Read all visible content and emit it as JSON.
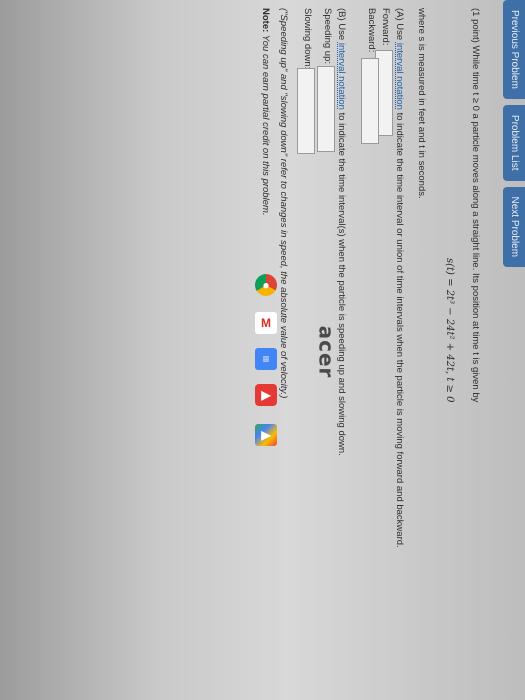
{
  "nav": {
    "previous": "Previous Problem",
    "list": "Problem List",
    "next": "Next Problem"
  },
  "problem": {
    "intro": "(1 point) While time t ≥ 0 a particle moves along a straight line. Its position at time t is given by",
    "equation": "s(t) = 2t³ − 24t² + 42t,   t ≥ 0",
    "where": "where s is measured in feet and t in seconds.",
    "part_a_label": "(A) Use",
    "part_a_link": "interval notation",
    "part_a_rest": "to indicate the time interval or union of time intervals when the particle is moving forward and backward.",
    "forward": "Forward:",
    "backward": "Backward:",
    "part_b_label": "(B) Use",
    "part_b_link": "interval notation",
    "part_b_rest": "to indicate the time interval(s) when the particle is speeding up and slowing down.",
    "speeding": "Speeding up:",
    "slowing": "Slowing down:",
    "quote_note": "(\"Speeding up\" and \"slowing down\" refer to changes in speed, the absolute value of velocity.)",
    "note_label": "Note:",
    "note_text": "You can earn partial credit on this problem."
  },
  "inputs": {
    "forward_value": "",
    "backward_value": "",
    "speeding_value": "",
    "slowing_value": ""
  },
  "device": {
    "brand": "acer"
  },
  "shelf_icons": [
    "chrome-icon",
    "gmail-icon",
    "docs-icon",
    "youtube-icon",
    "play-store-icon"
  ]
}
